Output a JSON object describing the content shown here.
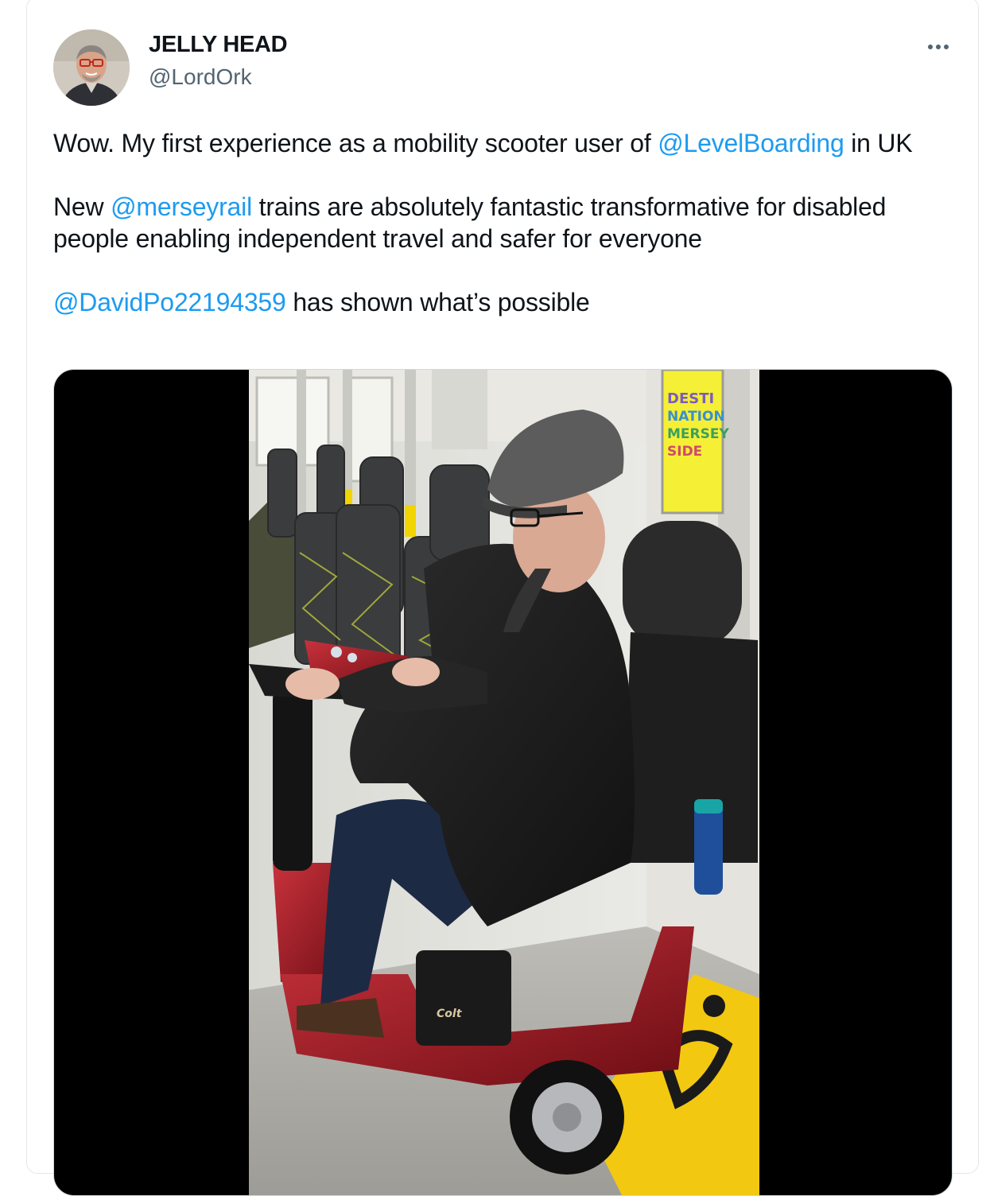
{
  "author": {
    "display_name": "JELLY HEAD",
    "handle": "@LordOrk"
  },
  "more_icon": "more-horizontal-icon",
  "tweet": {
    "p1": {
      "before": "Wow. My first experience as a mobility scooter user of ",
      "mention": "@LevelBoarding",
      "after": " in UK"
    },
    "p2": {
      "before": "New ",
      "mention": "@merseyrail",
      "after": " trains are absolutely fantastic transformative for disabled people enabling independent travel and safer for everyone"
    },
    "p3": {
      "mention": "@DavidPo22194359",
      "after": " has shown what’s possible"
    }
  },
  "media": {
    "poster_lines": [
      "DESTI",
      "NATION",
      "MERSEY",
      "SIDE"
    ],
    "scooter_badge": "Colt"
  },
  "colors": {
    "link": "#1d9bf0",
    "secondary_text": "#536471",
    "scooter_red": "#9c1420",
    "floor_yellow": "#f2c811"
  }
}
